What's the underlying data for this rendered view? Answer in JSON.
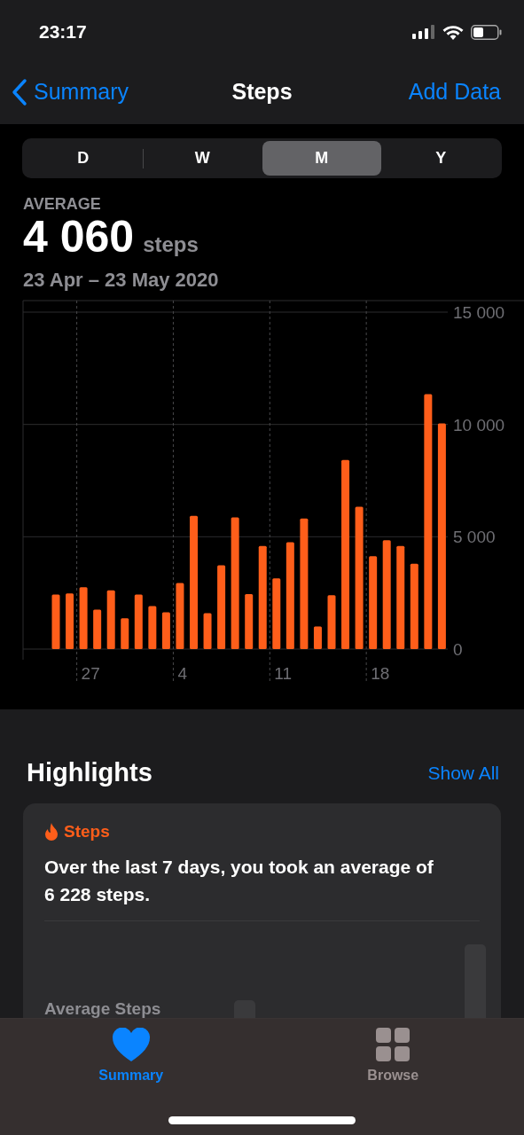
{
  "status_bar": {
    "time": "23:17"
  },
  "nav": {
    "back": "Summary",
    "title": "Steps",
    "action": "Add Data"
  },
  "segments": [
    {
      "label": "D",
      "selected": false
    },
    {
      "label": "W",
      "selected": false
    },
    {
      "label": "M",
      "selected": true
    },
    {
      "label": "Y",
      "selected": false
    }
  ],
  "summary": {
    "label": "AVERAGE",
    "value": "4 060",
    "unit": "steps",
    "range": "23 Apr – 23 May 2020"
  },
  "chart_data": {
    "type": "bar",
    "categories": [
      null,
      null,
      "27",
      null,
      null,
      null,
      null,
      null,
      null,
      "4",
      null,
      null,
      null,
      null,
      null,
      null,
      "11",
      null,
      null,
      null,
      null,
      null,
      null,
      "18",
      null,
      null,
      null,
      null,
      null
    ],
    "grid": true,
    "series": [
      {
        "color": "#ff5e1a",
        "values": [
          2430,
          2480,
          2750,
          1760,
          2620,
          1370,
          2430,
          1910,
          1640,
          2940,
          5930,
          1600,
          3730,
          5860,
          2450,
          4590,
          3150,
          4760,
          5810,
          1010,
          2400,
          8420,
          6340,
          4130,
          4850,
          4590,
          3800,
          11350,
          10050
        ]
      }
    ],
    "ylim": [
      0,
      15000
    ],
    "yticks": [
      {
        "value": 0,
        "label": "0"
      },
      {
        "value": 5000,
        "label": "5 000"
      },
      {
        "value": 10000,
        "label": "10 000"
      },
      {
        "value": 15000,
        "label": "15 000"
      }
    ]
  },
  "highlights": {
    "title": "Highlights",
    "show_all": "Show All",
    "card": {
      "category": "Steps",
      "text": "Over the last 7 days, you took an average of 6 228 steps.",
      "chart_label": "Average Steps"
    }
  },
  "tab_bar": [
    {
      "label": "Summary",
      "kind": "heart",
      "selected": true
    },
    {
      "label": "Browse",
      "kind": "grid",
      "selected": false
    }
  ]
}
